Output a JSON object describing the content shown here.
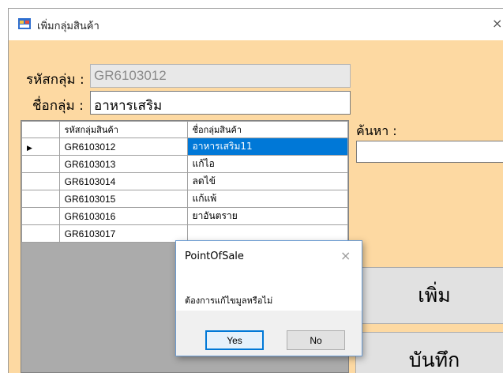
{
  "window": {
    "title": "เพิ่มกลุ่มสินค้า",
    "close_glyph": "×"
  },
  "form": {
    "code_label": "รหัสกลุ่ม :",
    "code_value": "GR6103012",
    "name_label": "ชื่อกลุ่ม :",
    "name_value": "อาหารเสริม"
  },
  "grid": {
    "columns": [
      "รหัสกลุ่มสินค้า",
      "ชื่อกลุ่มสินค้า"
    ],
    "rows": [
      {
        "code": "GR6103012",
        "name": "อาหารเสริม11",
        "selected": true
      },
      {
        "code": "GR6103013",
        "name": "แก้ไอ"
      },
      {
        "code": "GR6103014",
        "name": "ลดไข้"
      },
      {
        "code": "GR6103015",
        "name": "แก้แพ้"
      },
      {
        "code": "GR6103016",
        "name": "ยาอันตราย"
      },
      {
        "code": "GR6103017",
        "name": ""
      }
    ],
    "row_indicator": "▶"
  },
  "search": {
    "label": "ค้นหา :",
    "value": ""
  },
  "buttons": {
    "add": "เพิ่ม",
    "save": "บันทึก"
  },
  "dialog": {
    "title": "PointOfSale",
    "close_glyph": "×",
    "message": "ต้องการแก้ไขมูลหรือไม่",
    "yes": "Yes",
    "no": "No"
  },
  "colors": {
    "form_bg": "#fdd9a2",
    "selection": "#0078d7"
  }
}
